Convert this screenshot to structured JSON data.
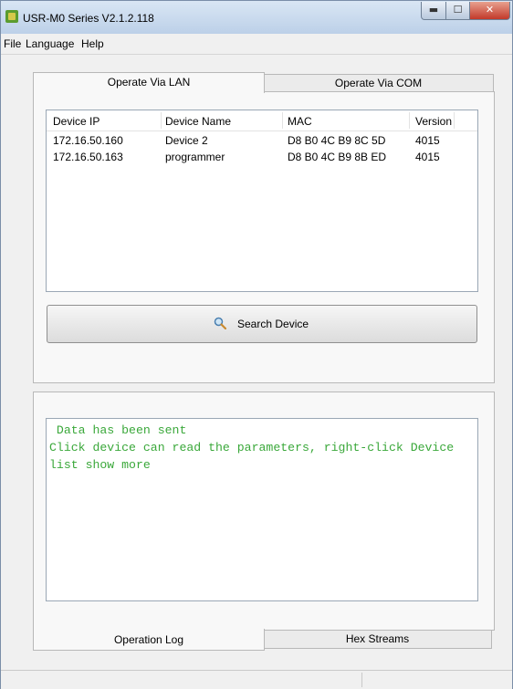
{
  "window": {
    "title": "USR-M0 Series V2.1.2.118",
    "controls": {
      "minimize": "▬",
      "maximize": "☐",
      "close": "✕"
    }
  },
  "menu": [
    "File",
    "Language",
    "Help"
  ],
  "top_tabs": {
    "active": "Operate Via LAN",
    "inactive": "Operate Via COM"
  },
  "device_table": {
    "headers": [
      "Device IP",
      "Device Name",
      "MAC",
      "Version"
    ],
    "rows": [
      [
        "172.16.50.160",
        "Device 2",
        "D8 B0 4C B9 8C 5D",
        "4015"
      ],
      [
        "172.16.50.163",
        "programmer",
        "D8 B0 4C B9 8B ED",
        "4015"
      ]
    ]
  },
  "search_button": {
    "label": "Search Device",
    "icon": "search-icon"
  },
  "log": {
    "lines": [
      " Data has been sent",
      "Click device can read the parameters, right-click Device",
      "list show more"
    ],
    "text_color": "#3aa83a"
  },
  "bottom_tabs": {
    "active": "Operation Log",
    "inactive": "Hex Streams"
  }
}
